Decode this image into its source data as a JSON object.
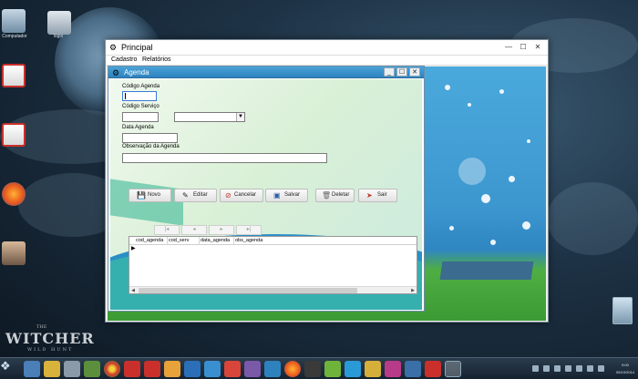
{
  "desktop": {
    "icons": [
      {
        "name": "computer",
        "label": "Computador"
      },
      {
        "name": "login",
        "label": "login"
      }
    ],
    "wallpaper_text": {
      "the": "THE",
      "main": "WITCHER",
      "sub": "WILD HUNT"
    }
  },
  "principal": {
    "title": "Principal",
    "menu": [
      "Cadastro",
      "Relatórios"
    ],
    "controls": {
      "minimize": "—",
      "maximize": "☐",
      "close": "✕"
    }
  },
  "agenda": {
    "title": "Agenda",
    "controls": {
      "minimize": "_",
      "maximize": "☐",
      "close": "✕"
    },
    "fields": {
      "codigo_agenda": {
        "label": "Código Agenda",
        "value": ""
      },
      "codigo_servico": {
        "label": "Código Serviço",
        "value": "",
        "select_value": ""
      },
      "data_agenda": {
        "label": "Data Agenda",
        "value": ""
      },
      "observacao": {
        "label": "Observação da Agenda",
        "value": ""
      }
    },
    "buttons": {
      "novo": "Novo",
      "editar": "Editar",
      "cancelar": "Cancelar",
      "salvar": "Salvar",
      "deletar": "Deletar",
      "sair": "Sair"
    },
    "nav": [
      "|◂",
      "◂",
      "▸",
      "▸|"
    ],
    "grid": {
      "columns": [
        "cod_agenda",
        "cod_serv",
        "data_agenda",
        "obs_agenda"
      ],
      "row_indicator": "▶"
    }
  },
  "taskbar": {
    "start_glyph": "❖",
    "clock": {
      "time": "9:00",
      "date": "05/10/2014"
    }
  },
  "colors": {
    "agenda_title": "#2d82be",
    "mdi_blue": "#3d97cf",
    "mdi_green": "#3c9a34"
  }
}
